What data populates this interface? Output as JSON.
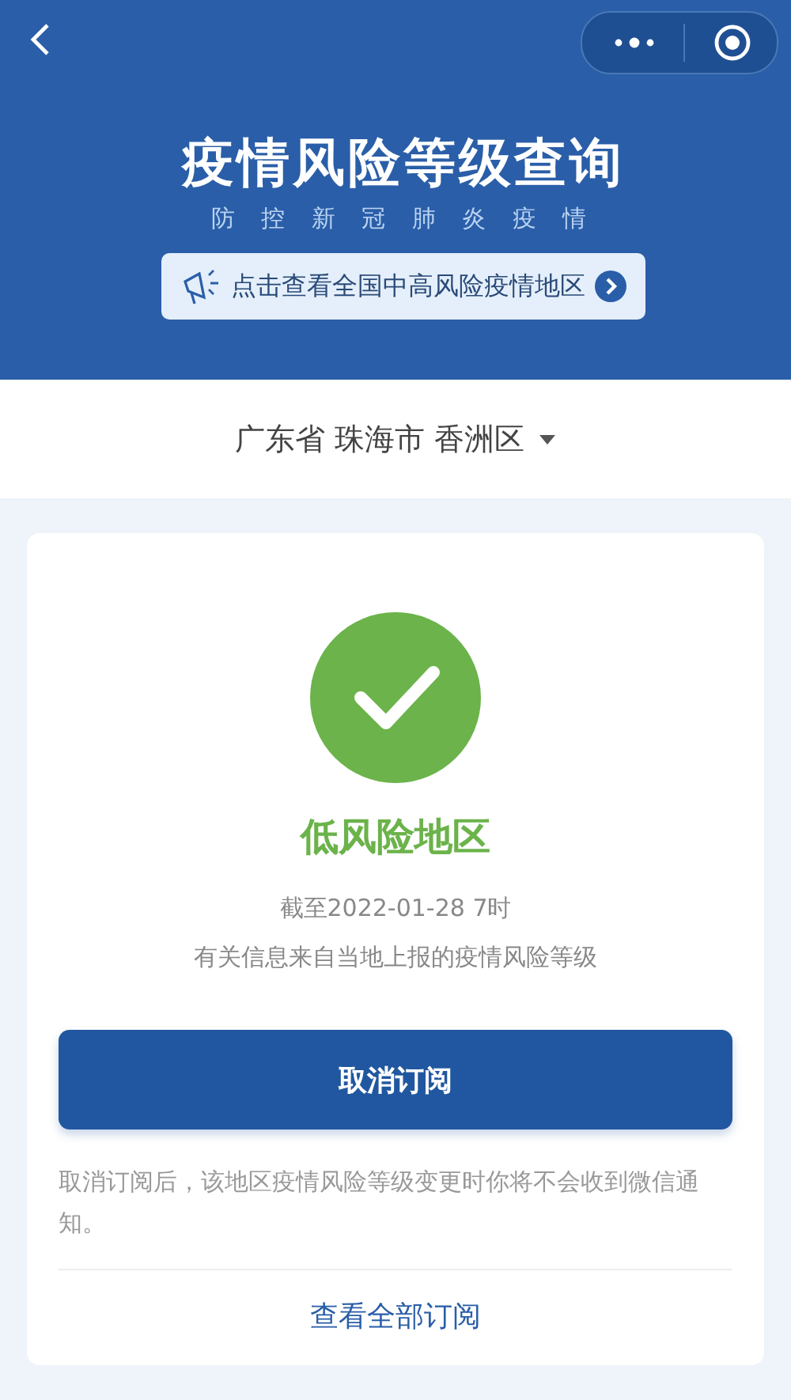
{
  "header": {
    "title": "疫情风险等级查询",
    "subtitle": "防 控 新 冠 肺 炎 疫 情",
    "banner": "点击查看全国中高风险疫情地区"
  },
  "region": {
    "label": "广东省 珠海市 香洲区"
  },
  "result": {
    "kind": "low",
    "risk": "低风险地区",
    "updated": "截至2022-01-28 7时",
    "source": "有关信息来自当地上报的疫情风险等级"
  },
  "unsubscribe_button": "取消订阅",
  "note": "取消订阅后，该地区疫情风险等级变更时你将不会收到微信通知。",
  "view_all_link": "查看全部订阅"
}
